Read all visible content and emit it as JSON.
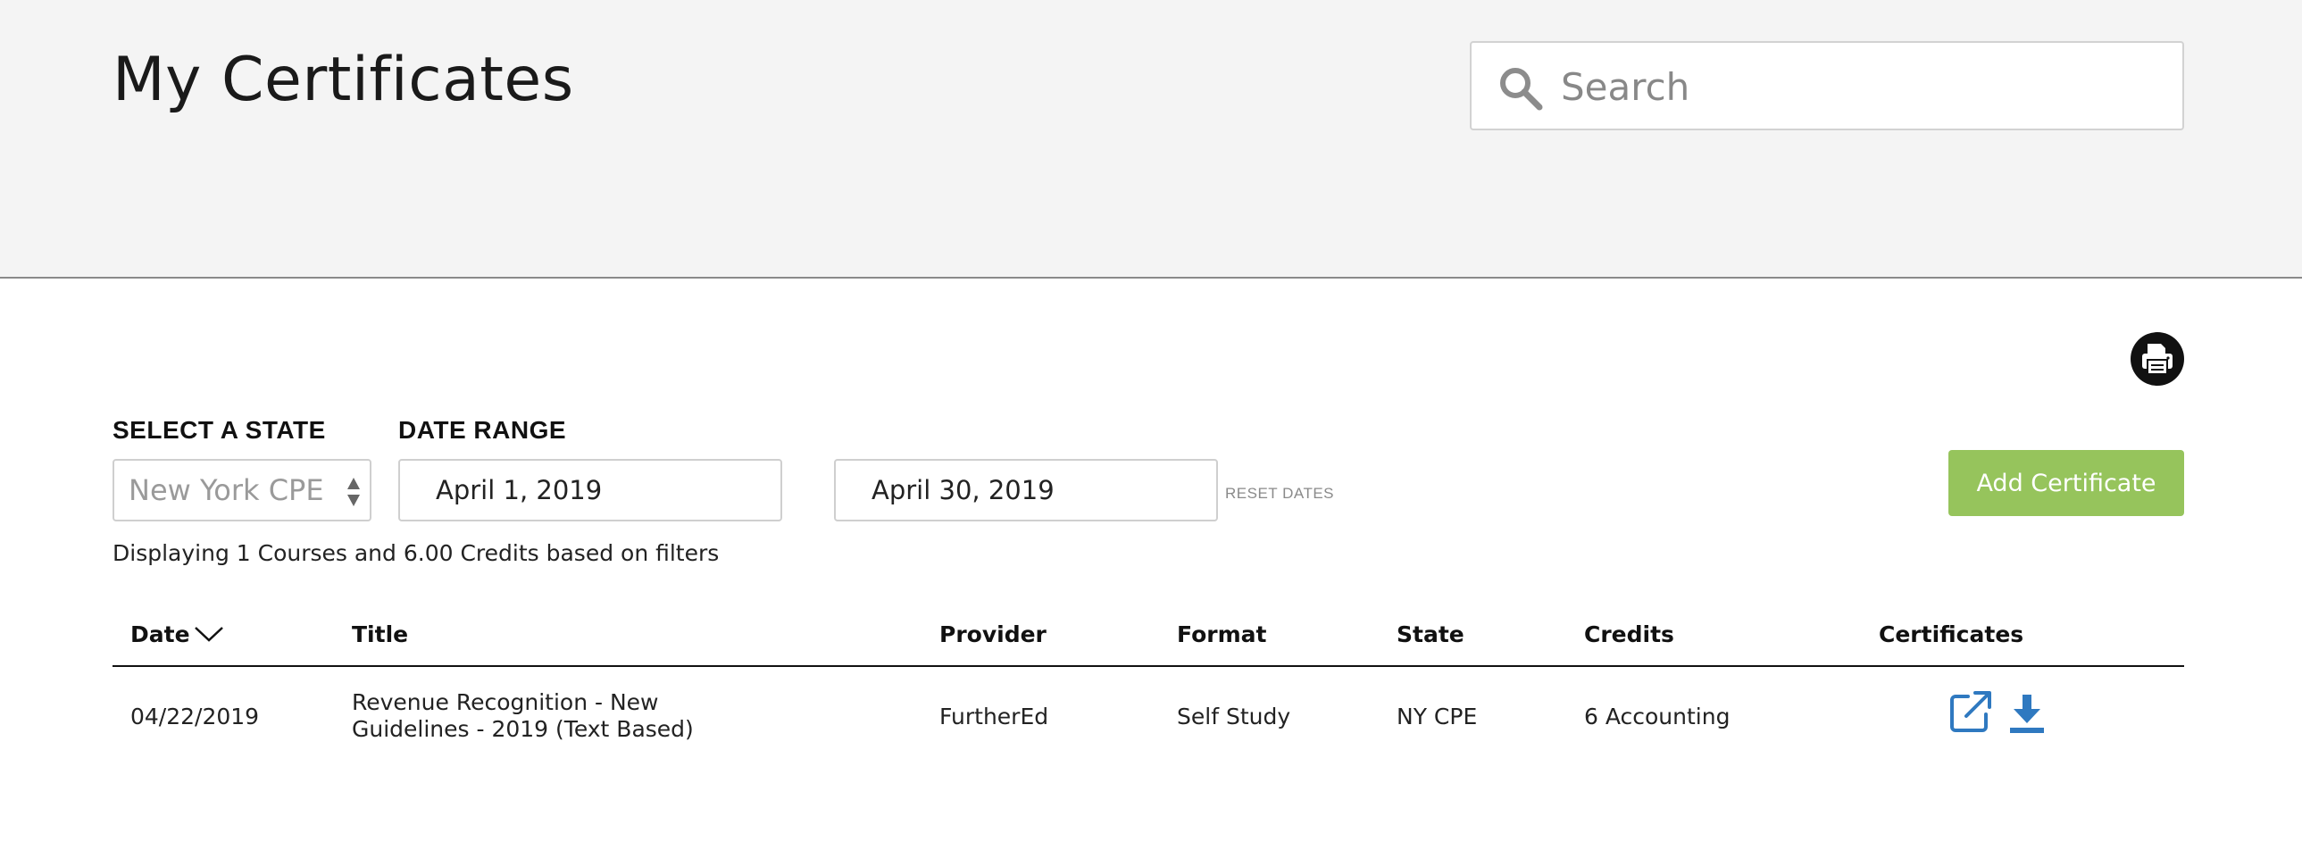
{
  "header": {
    "title": "My Certificates",
    "search_placeholder": "Search"
  },
  "filters": {
    "state_label": "SELECT A STATE",
    "state_selected": "New York CPE",
    "date_range_label": "DATE RANGE",
    "start_date": "April 1, 2019",
    "end_date": "April 30, 2019",
    "reset_label": "RESET DATES"
  },
  "actions": {
    "add_certificate_label": "Add Certificate",
    "print_icon": "printer-icon"
  },
  "summary": "Displaying 1 Courses and 6.00 Credits based on filters",
  "table": {
    "columns": [
      "Date",
      "Title",
      "Provider",
      "Format",
      "State",
      "Credits",
      "Certificates"
    ],
    "sort": "Date descending",
    "rows": [
      {
        "date": "04/22/2019",
        "title_line1": "Revenue Recognition - New",
        "title_line2": "Guidelines - 2019 (Text Based)",
        "provider": "FurtherEd",
        "format": "Self Study",
        "state": "NY CPE",
        "credits": "6 Accounting",
        "certificate_icons": [
          "external-link-icon",
          "download-icon"
        ]
      }
    ]
  },
  "colors": {
    "header_background": "#f4f4f4",
    "accent_green": "#96c45c",
    "icon_blue": "#2f79c0",
    "print_button": "#111111"
  }
}
